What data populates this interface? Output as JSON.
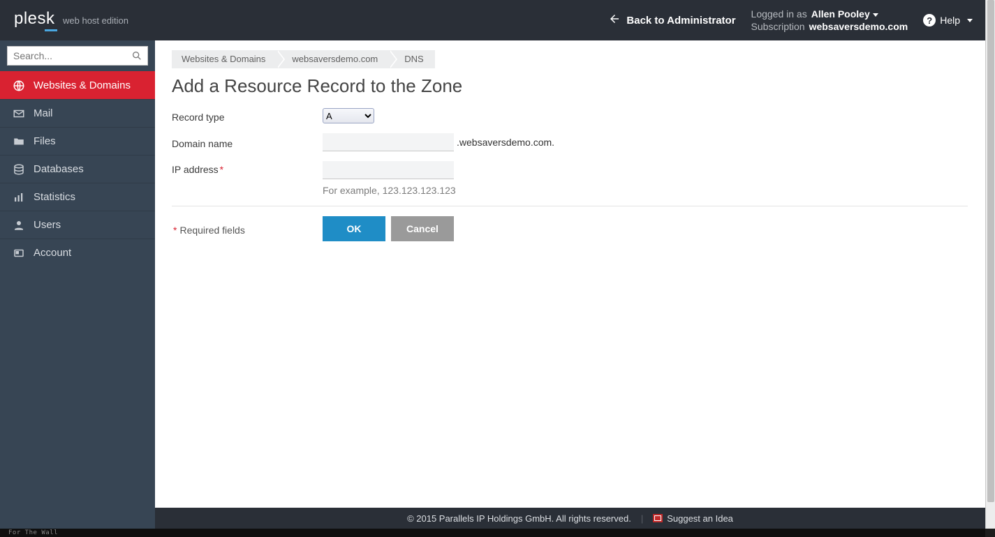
{
  "brand": {
    "name": "plesk",
    "edition": "web host edition"
  },
  "header": {
    "back_label": "Back to Administrator",
    "logged_in_as": "Logged in as",
    "user_name": "Allen Pooley",
    "subscription_label": "Subscription",
    "subscription_value": "websaversdemo.com",
    "help_label": "Help"
  },
  "sidebar": {
    "search_placeholder": "Search...",
    "items": [
      {
        "id": "websites-domains",
        "label": "Websites & Domains",
        "icon": "globe-icon",
        "active": true
      },
      {
        "id": "mail",
        "label": "Mail",
        "icon": "mail-icon"
      },
      {
        "id": "files",
        "label": "Files",
        "icon": "folder-icon"
      },
      {
        "id": "databases",
        "label": "Databases",
        "icon": "database-icon"
      },
      {
        "id": "statistics",
        "label": "Statistics",
        "icon": "stats-icon"
      },
      {
        "id": "users",
        "label": "Users",
        "icon": "user-icon"
      },
      {
        "id": "account",
        "label": "Account",
        "icon": "account-icon"
      }
    ]
  },
  "breadcrumbs": [
    {
      "label": "Websites & Domains"
    },
    {
      "label": "websaversdemo.com"
    },
    {
      "label": "DNS"
    }
  ],
  "page": {
    "title": "Add a Resource Record to the Zone"
  },
  "form": {
    "record_type": {
      "label": "Record type",
      "value": "A",
      "options": [
        "A"
      ]
    },
    "domain_name": {
      "label": "Domain name",
      "value": "",
      "suffix": ".websaversdemo.com."
    },
    "ip_address": {
      "label": "IP address",
      "required": true,
      "value": "",
      "hint": "For example, 123.123.123.123"
    },
    "required_fields": "Required fields",
    "ok": "OK",
    "cancel": "Cancel"
  },
  "footer": {
    "copyright": "© 2015 Parallels IP Holdings GmbH. All rights reserved.",
    "suggest": "Suggest an Idea"
  },
  "bottom_strip": "For The Wall"
}
